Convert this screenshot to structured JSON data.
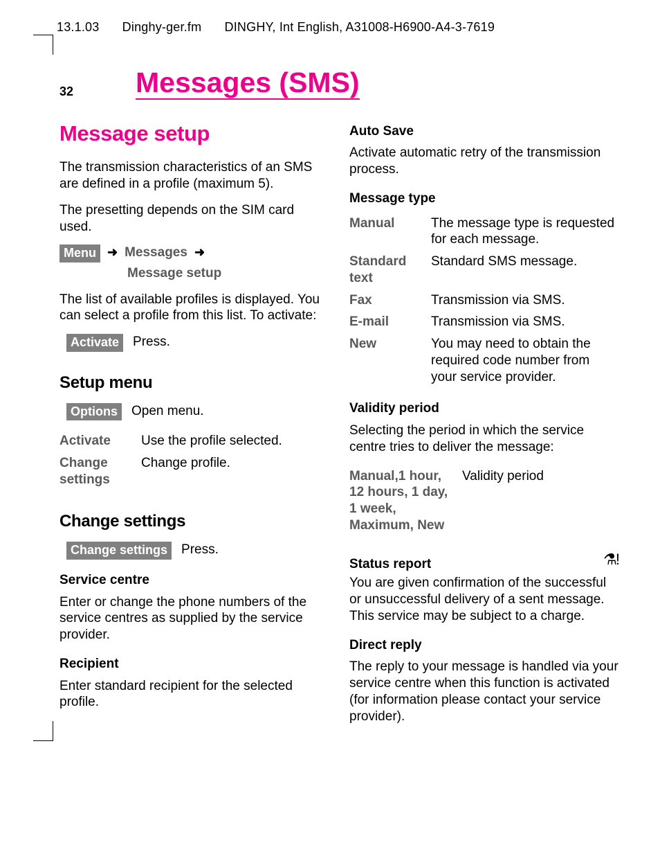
{
  "header": {
    "date": "13.1.03",
    "file": "Dinghy-ger.fm",
    "doc": "DINGHY, Int English, A31008-H6900-A4-3-7619"
  },
  "page_number": "32",
  "chapter_title": "Messages (SMS)",
  "left": {
    "h1": "Message setup",
    "p1": "The transmission characteristics of an SMS are defined in a profile (maximum 5).",
    "p2": "The presetting depends on the SIM card used.",
    "menu_key": "Menu",
    "arrow": "➜",
    "nav1": "Messages",
    "nav2": "Message setup",
    "p3": "The list of available profiles is displayed. You can select a profile from this list. To activate:",
    "activate_key": "Activate",
    "activate_desc": "Press.",
    "h2_setup": "Setup menu",
    "options_key": "Options",
    "options_desc": "Open menu.",
    "setup_table": [
      {
        "term": "Activate",
        "desc": "Use the profile selected."
      },
      {
        "term": "Change settings",
        "desc": "Change profile."
      }
    ],
    "h2_change": "Change settings",
    "change_key": "Change settings",
    "change_desc": "Press.",
    "h3_service": "Service centre",
    "p_service": "Enter or change the phone numbers of the service centres as supplied by the service provider.",
    "h3_recipient": "Recipient",
    "p_recipient": "Enter standard recipient for the selected profile."
  },
  "right": {
    "h3_autosave": "Auto Save",
    "p_autosave": "Activate automatic retry of the transmission process.",
    "h3_msgtype": "Message type",
    "msgtype_table": [
      {
        "term": "Manual",
        "desc": "The message type is requested for each message."
      },
      {
        "term": "Standard text",
        "desc": "Standard SMS message."
      },
      {
        "term": "Fax",
        "desc": "Transmission via SMS."
      },
      {
        "term": "E-mail",
        "desc": "Transmission via SMS."
      },
      {
        "term": "New",
        "desc": "You may need to obtain the required code number from your service provider."
      }
    ],
    "h3_validity": "Validity period",
    "p_validity": "Selecting the period in which the service centre tries to deliver the message:",
    "validity_table": [
      {
        "term": "Manual,1 hour, 12 hours, 1 day, 1 week, Maximum, New",
        "desc": "Validity period"
      }
    ],
    "h3_status": "Status report",
    "status_icon": "⚗!",
    "p_status": "You are given confirmation of the successful or unsuccessful delivery of a sent message. This service may be subject to a charge.",
    "h3_direct": "Direct reply",
    "p_direct": "The reply to your message is handled via your service centre when this function is activated (for information please contact your service provider)."
  }
}
